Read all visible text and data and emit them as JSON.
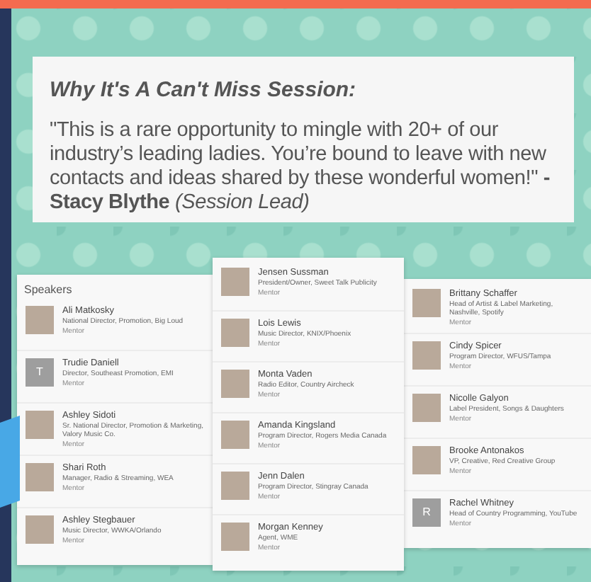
{
  "quote": {
    "heading": "Why It's A Can't Miss Session:",
    "text": "\"This is a rare opportunity to mingle with 20+ of our industry’s leading ladies.  You’re bound to leave with new contacts and ideas shared by these wonderful women!\" **- Stacy Blythe** *(Session Lead)*"
  },
  "columns": [
    {
      "heading": "Speakers",
      "speakers": [
        {
          "name": "Ali Matkosky",
          "title": "National Director, Promotion, Big Loud",
          "role": "Mentor",
          "avatar": {
            "kind": "photo"
          }
        },
        {
          "name": "Trudie Daniell",
          "title": "Director, Southeast Promotion, EMI",
          "role": "Mentor",
          "avatar": {
            "kind": "initial",
            "letter": "T"
          }
        },
        {
          "name": "Ashley Sidoti",
          "title": "Sr. National Director, Promotion & Marketing, Valory Music Co.",
          "role": "Mentor",
          "avatar": {
            "kind": "photo"
          }
        },
        {
          "name": "Shari Roth",
          "title": "Manager, Radio & Streaming, WEA",
          "role": "Mentor",
          "avatar": {
            "kind": "photo"
          }
        },
        {
          "name": "Ashley Stegbauer",
          "title": "Music Director, WWKA/Orlando",
          "role": "Mentor",
          "avatar": {
            "kind": "photo"
          }
        }
      ]
    },
    {
      "speakers": [
        {
          "name": "Jensen Sussman",
          "title": "President/Owner, Sweet Talk Publicity",
          "role": "Mentor",
          "avatar": {
            "kind": "photo"
          }
        },
        {
          "name": "Lois Lewis",
          "title": "Music Director, KNIX/Phoenix",
          "role": "Mentor",
          "avatar": {
            "kind": "photo"
          }
        },
        {
          "name": "Monta Vaden",
          "title": "Radio Editor, Country Aircheck",
          "role": "Mentor",
          "avatar": {
            "kind": "photo"
          }
        },
        {
          "name": "Amanda Kingsland",
          "title": "Program Director, Rogers Media Canada",
          "role": "Mentor",
          "avatar": {
            "kind": "photo"
          }
        },
        {
          "name": "Jenn Dalen",
          "title": "Program Director, Stingray Canada",
          "role": "Mentor",
          "avatar": {
            "kind": "photo"
          }
        },
        {
          "name": "Morgan Kenney",
          "title": "Agent, WME",
          "role": "Mentor",
          "avatar": {
            "kind": "photo"
          }
        }
      ]
    },
    {
      "speakers": [
        {
          "name": "Brittany Schaffer",
          "title": "Head of Artist & Label Marketing, Nashville, Spotify",
          "role": "Mentor",
          "avatar": {
            "kind": "photo"
          }
        },
        {
          "name": "Cindy Spicer",
          "title": "Program Director, WFUS/Tampa",
          "role": "Mentor",
          "avatar": {
            "kind": "photo"
          }
        },
        {
          "name": "Nicolle Galyon",
          "title": "Label President, Songs & Daughters",
          "role": "Mentor",
          "avatar": {
            "kind": "photo"
          }
        },
        {
          "name": "Brooke Antonakos",
          "title": "VP, Creative, Red Creative Group",
          "role": "Mentor",
          "avatar": {
            "kind": "photo"
          }
        },
        {
          "name": "Rachel Whitney",
          "title": "Head of Country Programming, YouTube",
          "role": "Mentor",
          "avatar": {
            "kind": "initial",
            "letter": "R"
          }
        }
      ]
    }
  ]
}
